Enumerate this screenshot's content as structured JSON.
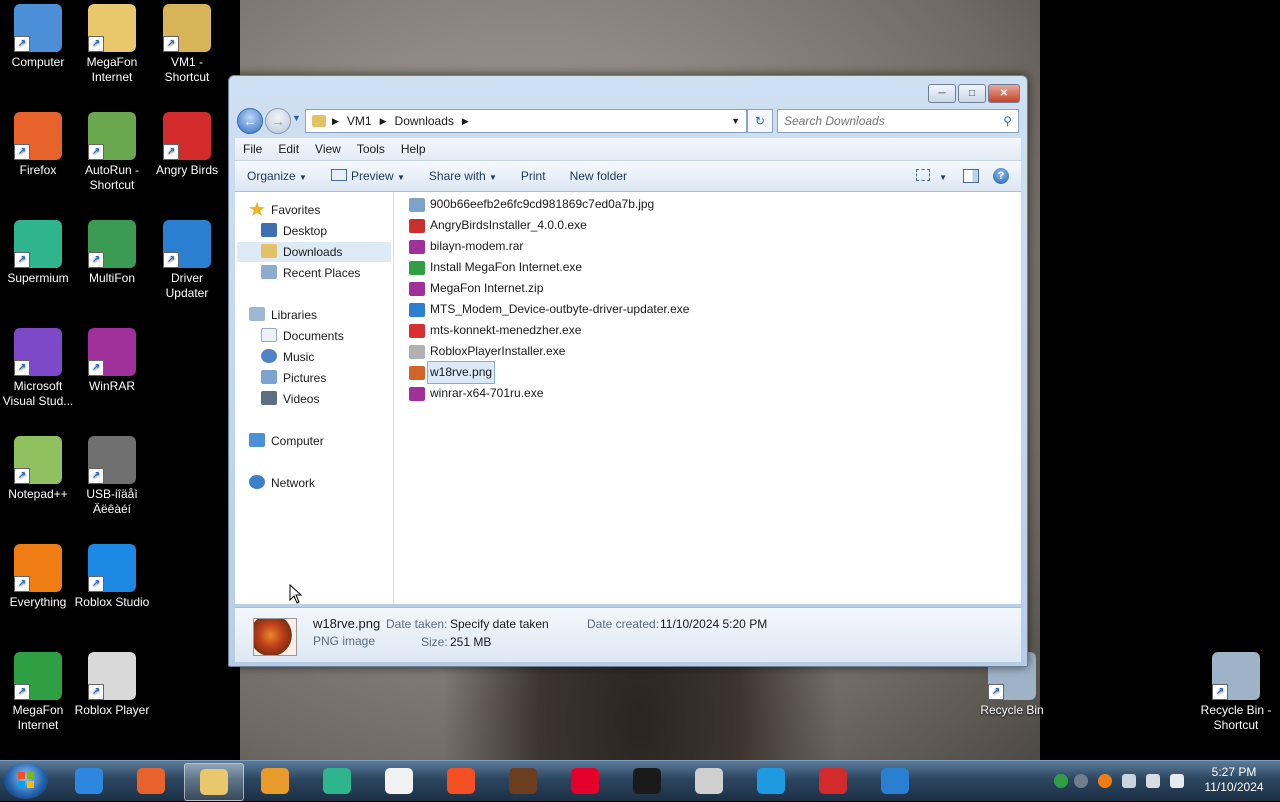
{
  "desktop": {
    "icons": [
      {
        "label": "Computer",
        "icon": "computer-icon",
        "color": "#4a8fd8"
      },
      {
        "label": "MegaFon Internet",
        "icon": "folder-icon",
        "color": "#e8c86a"
      },
      {
        "label": "VM1 - Shortcut",
        "icon": "user-folder-icon",
        "color": "#d6b457"
      },
      {
        "label": "Firefox",
        "icon": "firefox-icon",
        "color": "#e8632b"
      },
      {
        "label": "AutoRun - Shortcut",
        "icon": "autorun-icon",
        "color": "#6aa84f"
      },
      {
        "label": "Angry Birds",
        "icon": "angry-birds-icon",
        "color": "#d32b2b"
      },
      {
        "label": "Supermium",
        "icon": "supermium-icon",
        "color": "#2fb58e"
      },
      {
        "label": "MultiFon",
        "icon": "phone-icon",
        "color": "#3a9a52"
      },
      {
        "label": "Driver Updater",
        "icon": "driver-updater-icon",
        "color": "#2a7fd0"
      },
      {
        "label": "Microsoft Visual Stud...",
        "icon": "visual-studio-icon",
        "color": "#7d49c9"
      },
      {
        "label": "WinRAR",
        "icon": "winrar-icon",
        "color": "#a0309a"
      },
      {
        "label": "Notepad++",
        "icon": "notepad-plus-icon",
        "color": "#8fc25e"
      },
      {
        "label": "USB-iîäåì Äëêàéí",
        "icon": "usb-modem-icon",
        "color": "#6f6f6f"
      },
      {
        "label": "Everything",
        "icon": "everything-icon",
        "color": "#f07d14"
      },
      {
        "label": "Roblox Studio",
        "icon": "roblox-studio-icon",
        "color": "#1e88e5"
      },
      {
        "label": "MegaFon Internet",
        "icon": "megafon-icon",
        "color": "#2ea043"
      },
      {
        "label": "Roblox Player",
        "icon": "roblox-icon",
        "color": "#d9d9d9"
      },
      {
        "label": "Recycle Bin",
        "icon": "recycle-bin-icon",
        "color": "#9fb3c8"
      },
      {
        "label": "Recycle Bin - Shortcut",
        "icon": "recycle-bin-icon",
        "color": "#9fb3c8"
      }
    ]
  },
  "window": {
    "address": [
      "VM1",
      "Downloads"
    ],
    "search_placeholder": "Search Downloads",
    "menu": [
      "File",
      "Edit",
      "View",
      "Tools",
      "Help"
    ],
    "commands": {
      "organize": "Organize",
      "preview": "Preview",
      "share": "Share with",
      "print": "Print",
      "new_folder": "New folder"
    },
    "nav": {
      "favorites": "Favorites",
      "desktop": "Desktop",
      "downloads": "Downloads",
      "recent": "Recent Places",
      "libraries": "Libraries",
      "documents": "Documents",
      "music": "Music",
      "pictures": "Pictures",
      "videos": "Videos",
      "computer": "Computer",
      "network": "Network"
    },
    "files": [
      {
        "name": "900b66eefb2e6fc9cd981869c7ed0a7b.jpg",
        "icon": "image-file-icon",
        "color": "#7fa3c8"
      },
      {
        "name": "AngryBirdsInstaller_4.0.0.exe",
        "icon": "angry-birds-icon",
        "color": "#c9302c"
      },
      {
        "name": "bilayn-modem.rar",
        "icon": "winrar-icon",
        "color": "#a0309a"
      },
      {
        "name": "Install MegaFon Internet.exe",
        "icon": "megafon-icon",
        "color": "#2ea043"
      },
      {
        "name": "MegaFon Internet.zip",
        "icon": "winrar-icon",
        "color": "#a0309a"
      },
      {
        "name": "MTS_Modem_Device-outbyte-driver-updater.exe",
        "icon": "driver-updater-icon",
        "color": "#2a7fd0"
      },
      {
        "name": "mts-konnekt-menedzher.exe",
        "icon": "mts-icon",
        "color": "#d83030"
      },
      {
        "name": "RobloxPlayerInstaller.exe",
        "icon": "roblox-icon",
        "color": "#b0b0b0"
      },
      {
        "name": "w18rve.png",
        "icon": "image-file-icon",
        "color": "#d0642a",
        "selected": true
      },
      {
        "name": "winrar-x64-701ru.exe",
        "icon": "winrar-icon",
        "color": "#a0309a"
      }
    ],
    "details": {
      "filename": "w18rve.png",
      "type": "PNG image",
      "date_taken_label": "Date taken:",
      "date_taken_value": "Specify date taken",
      "size_label": "Size:",
      "size_value": "251 MB",
      "date_created_label": "Date created:",
      "date_created_value": "11/10/2024 5:20 PM"
    }
  },
  "taskbar": {
    "items": [
      {
        "icon": "internet-explorer-icon",
        "color": "#2e86de"
      },
      {
        "icon": "firefox-icon",
        "color": "#e8632b"
      },
      {
        "icon": "file-explorer-icon",
        "color": "#e8c86a",
        "active": true
      },
      {
        "icon": "media-player-icon",
        "color": "#e89a2a"
      },
      {
        "icon": "supermium-icon",
        "color": "#2fb58e"
      },
      {
        "icon": "youtube-icon",
        "color": "#f2f2f2"
      },
      {
        "icon": "windows-store-icon",
        "color": "#f25022"
      },
      {
        "icon": "ups-icon",
        "color": "#6b3e1f"
      },
      {
        "icon": "bank-of-america-icon",
        "color": "#e4002b"
      },
      {
        "icon": "shopping-bag-icon",
        "color": "#1a1a1a"
      },
      {
        "icon": "roblox-icon",
        "color": "#cfcfcf"
      },
      {
        "icon": "edge-icon",
        "color": "#1e9be0"
      },
      {
        "icon": "angry-birds-icon",
        "color": "#d32b2b"
      },
      {
        "icon": "driver-updater-icon",
        "color": "#2a7fd0"
      }
    ],
    "time": "5:27 PM",
    "date": "11/10/2024"
  }
}
